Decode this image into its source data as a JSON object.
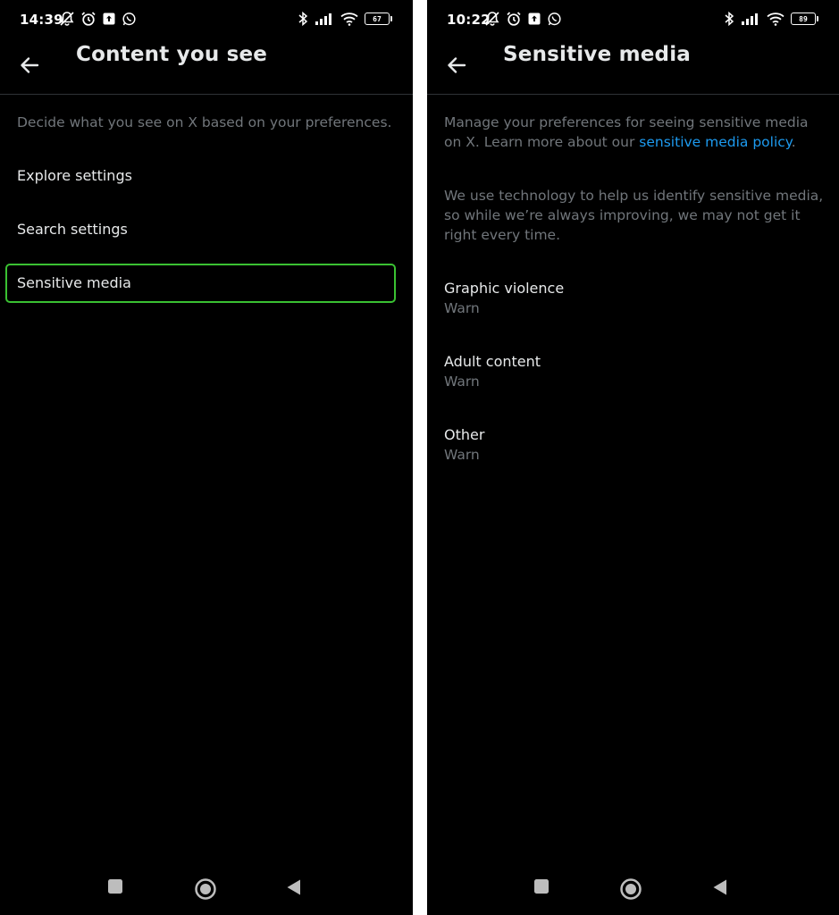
{
  "left": {
    "status": {
      "time": "14:39",
      "battery": "67"
    },
    "header": {
      "title": "Content you see"
    },
    "description": "Decide what you see on X based on your preferences.",
    "menu": [
      {
        "label": "Explore settings"
      },
      {
        "label": "Search settings"
      },
      {
        "label": "Sensitive media"
      }
    ],
    "highlight_color": "#3ac132"
  },
  "right": {
    "status": {
      "time": "10:22",
      "battery": "89"
    },
    "header": {
      "title": "Sensitive media"
    },
    "intro": {
      "text": "Manage your preferences for seeing sensitive media on X. Learn more about our ",
      "link": "sensitive media policy",
      "after": "."
    },
    "note_line1": "We use technology to help us identify sensitive media,",
    "note_line2": "so while we’re always improving, we may not get it",
    "note_line3": "right every time.",
    "settings": [
      {
        "title": "Graphic violence",
        "value": "Warn"
      },
      {
        "title": "Adult content",
        "value": "Warn"
      },
      {
        "title": "Other",
        "value": "Warn"
      }
    ]
  },
  "colors": {
    "background": "#000000",
    "text": "#e7e9ea",
    "muted": "#71767b",
    "link": "#1d9bf0"
  },
  "icons": [
    "back-arrow-icon",
    "mute-icon",
    "alarm-icon",
    "upload-icon",
    "whatsapp-icon",
    "bluetooth-icon",
    "signal-icon",
    "wifi-icon",
    "battery-icon",
    "recents-icon",
    "home-icon",
    "back-nav-icon"
  ]
}
